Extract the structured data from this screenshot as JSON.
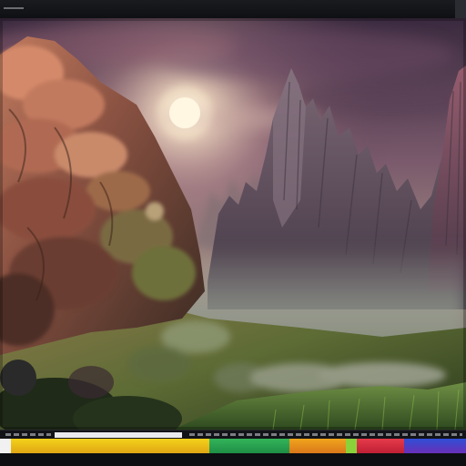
{
  "viewer": {
    "icons": {
      "top_grip": "drag-handle-icon"
    },
    "palette_bar": {
      "colors": [
        "#f1f1f1",
        "#f3d21a",
        "#33b45a",
        "#f0a51c",
        "#8bd23a",
        "#e53b4a",
        "#2f4fd6"
      ]
    }
  },
  "scene": {
    "subjects": [
      "sun",
      "forest-cliff",
      "rock-spires",
      "misty-valley",
      "grass-hill"
    ],
    "colors": {
      "sky_top": "#3a2a3f",
      "sky_glow": "#f5e8d6",
      "sun": "#fffbe8",
      "foliage_warm": "#b56a4d",
      "foliage_dark": "#3b2a22",
      "rock": "#5f4e5e",
      "mist": "#8c8f90",
      "grass": "#4d7a2f"
    }
  }
}
